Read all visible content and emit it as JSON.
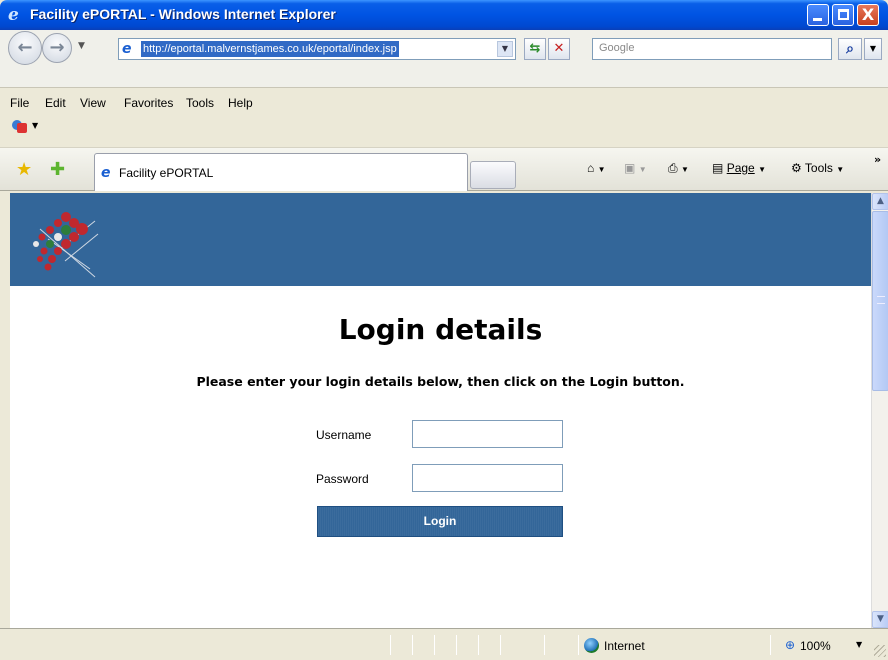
{
  "window": {
    "title": "Facility ePORTAL - Windows Internet Explorer",
    "controls": {
      "minimize": "",
      "maximize": "",
      "close": "X"
    }
  },
  "address_bar": {
    "url": "http://eportal.malvernstjames.co.uk/eportal/index.jsp",
    "search_placeholder": "Google"
  },
  "menu": {
    "items": [
      "File",
      "Edit",
      "View",
      "Favorites",
      "Tools",
      "Help"
    ]
  },
  "tabs": {
    "active_label": "Facility ePORTAL"
  },
  "command_bar": {
    "page_label": "Page",
    "tools_label": "Tools"
  },
  "page": {
    "heading": "Login details",
    "instructions": "Please enter your login details below, then click on the Login button.",
    "username_label": "Username",
    "password_label": "Password",
    "username_value": "",
    "password_value": "",
    "login_button": "Login"
  },
  "status_bar": {
    "zone": "Internet",
    "zoom": "100%"
  },
  "colors": {
    "banner": "#336699",
    "titlebar": "#0054e3"
  }
}
